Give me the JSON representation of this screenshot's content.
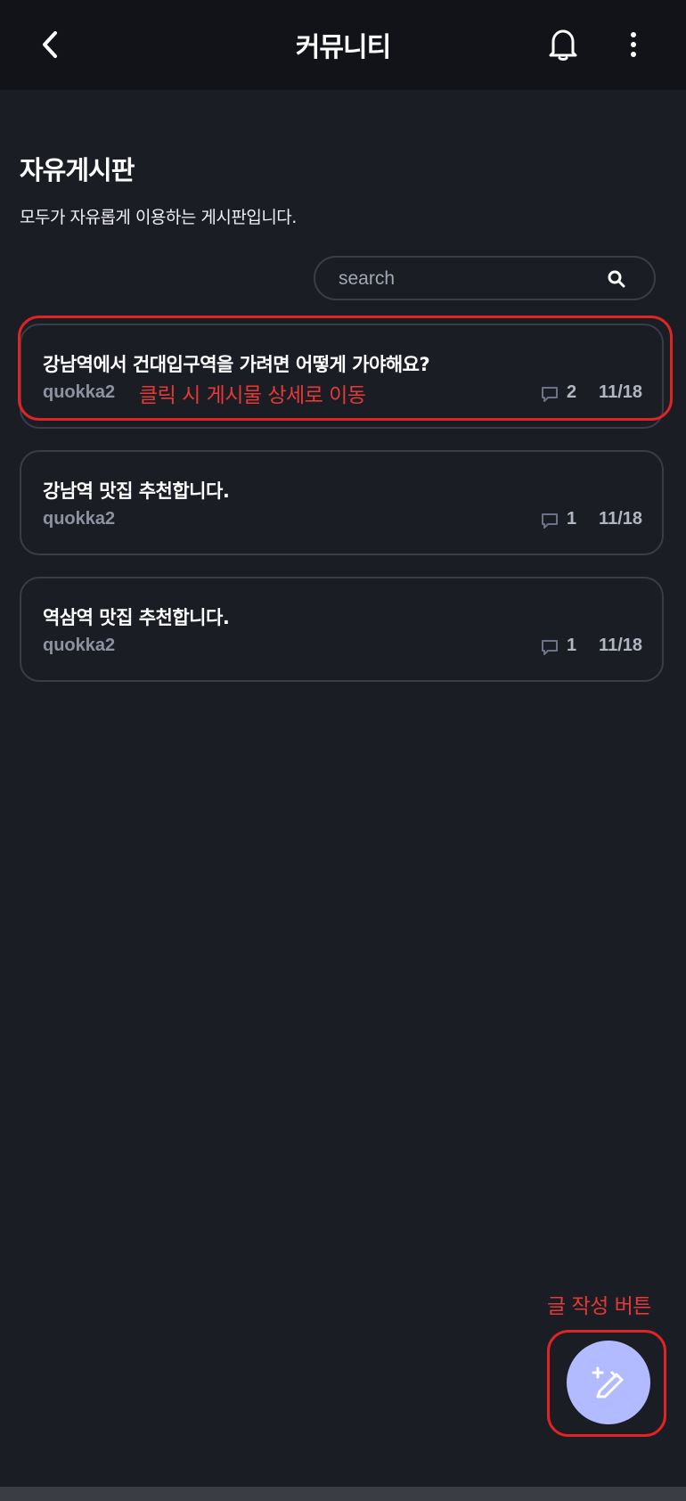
{
  "header": {
    "title": "커뮤니티",
    "back_icon": "chevron-left-icon",
    "bell_icon": "bell-icon",
    "more_icon": "more-vertical-icon"
  },
  "board": {
    "title": "자유게시판",
    "description": "모두가 자유롭게 이용하는 게시판입니다."
  },
  "search": {
    "placeholder": "search",
    "value": "",
    "icon": "search-icon"
  },
  "posts": [
    {
      "title": "강남역에서 건대입구역을 가려면 어떻게 가야해요?",
      "author": "quokka2",
      "comments": "2",
      "date": "11/18"
    },
    {
      "title": "강남역 맛집 추천합니다.",
      "author": "quokka2",
      "comments": "1",
      "date": "11/18"
    },
    {
      "title": "역삼역 맛집 추천합니다.",
      "author": "quokka2",
      "comments": "1",
      "date": "11/18"
    }
  ],
  "annotations": {
    "post_click": "클릭 시 게시물 상세로 이동",
    "write_button": "글 작성 버튼",
    "color": "#e02424"
  },
  "fab": {
    "icon": "magic-pen-icon",
    "color": "#b2bbff"
  },
  "colors": {
    "background": "#1b1d25",
    "header": "#111318",
    "card_border": "#3a3d48",
    "muted_text": "#8e92a0"
  }
}
